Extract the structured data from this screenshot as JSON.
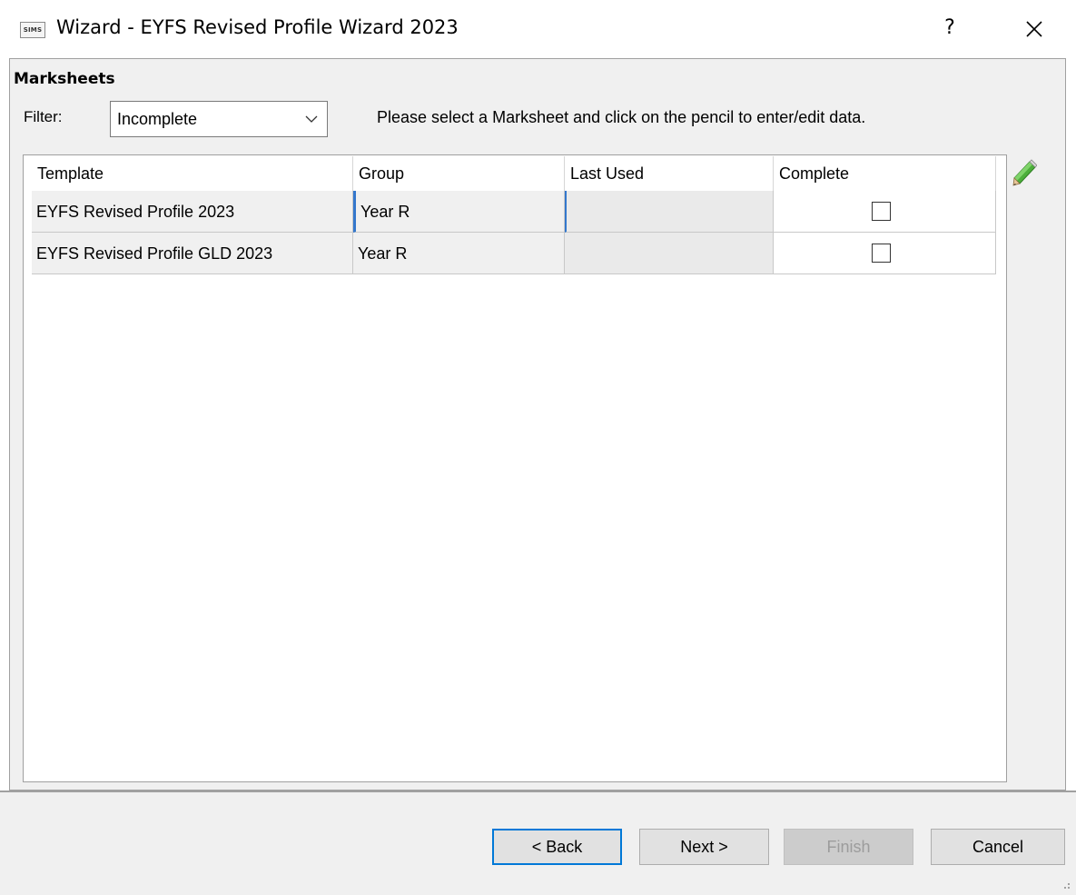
{
  "window": {
    "icon_text": "SIMS",
    "title": "Wizard - EYFS Revised Profile Wizard 2023",
    "help_label": "?"
  },
  "section": {
    "title": "Marksheets"
  },
  "filter": {
    "label": "Filter:",
    "value": "Incomplete",
    "instruction": "Please select a Marksheet and click on the pencil to enter/edit data."
  },
  "grid": {
    "columns": [
      "Template",
      "Group",
      "Last Used",
      "Complete"
    ],
    "rows": [
      {
        "template": "EYFS Revised Profile 2023",
        "group": "Year  R",
        "last_used": "",
        "complete": false
      },
      {
        "template": "EYFS Revised Profile GLD 2023",
        "group": "Year  R",
        "last_used": "",
        "complete": false
      }
    ]
  },
  "icons": {
    "edit": "pencil-icon",
    "close": "close-icon",
    "dropdown": "chevron-down-icon"
  },
  "buttons": {
    "back": "< Back",
    "next": "Next >",
    "finish": "Finish",
    "cancel": "Cancel"
  },
  "colors": {
    "accent": "#0078d7",
    "panel_bg": "#f0f0f0",
    "pencil_green": "#4caf3a"
  }
}
